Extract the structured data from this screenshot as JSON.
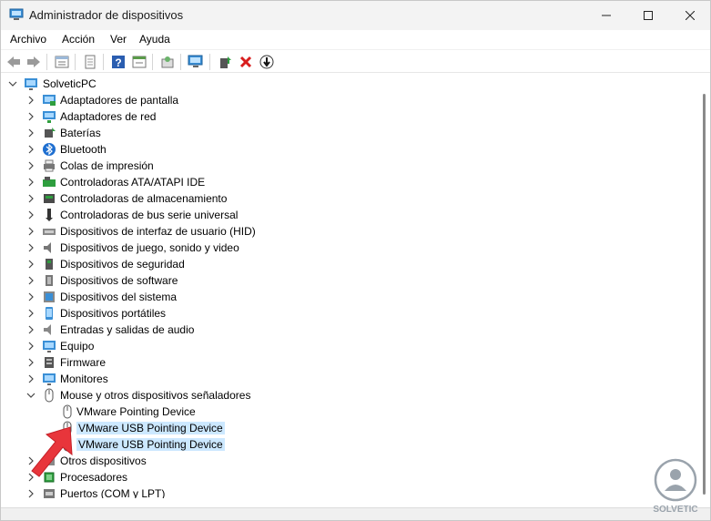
{
  "window": {
    "title": "Administrador de dispositivos"
  },
  "menu": {
    "items": [
      "Archivo",
      "Acción",
      "Ver",
      "Ayuda"
    ]
  },
  "toolbar": {
    "buttons": [
      "back-icon",
      "forward-icon",
      "properties-icon",
      "show-hidden-icon",
      "help-icon",
      "view-icon",
      "update-driver-icon",
      "scan-hardware-icon",
      "add-driver-icon",
      "uninstall-icon",
      "disable-icon"
    ]
  },
  "tree": {
    "root": "SolveticPC",
    "categories": [
      "Adaptadores de pantalla",
      "Adaptadores de red",
      "Baterías",
      "Bluetooth",
      "Colas de impresión",
      "Controladoras ATA/ATAPI IDE",
      "Controladoras de almacenamiento",
      "Controladoras de bus serie universal",
      "Dispositivos de interfaz de usuario (HID)",
      "Dispositivos de juego, sonido y video",
      "Dispositivos de seguridad",
      "Dispositivos de software",
      "Dispositivos del sistema",
      "Dispositivos portátiles",
      "Entradas y salidas de audio",
      "Equipo",
      "Firmware",
      "Monitores",
      "Mouse y otros dispositivos señaladores"
    ],
    "mouse_children": [
      "VMware Pointing Device",
      "VMware USB Pointing Device",
      "VMware USB Pointing Device"
    ],
    "after": [
      "Otros dispositivos",
      "Procesadores",
      "Puertos (COM y LPT)"
    ]
  },
  "colors": {
    "selection": "#cce8ff",
    "arrow": "#e8353b",
    "accent": "#0067c0"
  },
  "logo": {
    "text": "SOLVETIC"
  }
}
